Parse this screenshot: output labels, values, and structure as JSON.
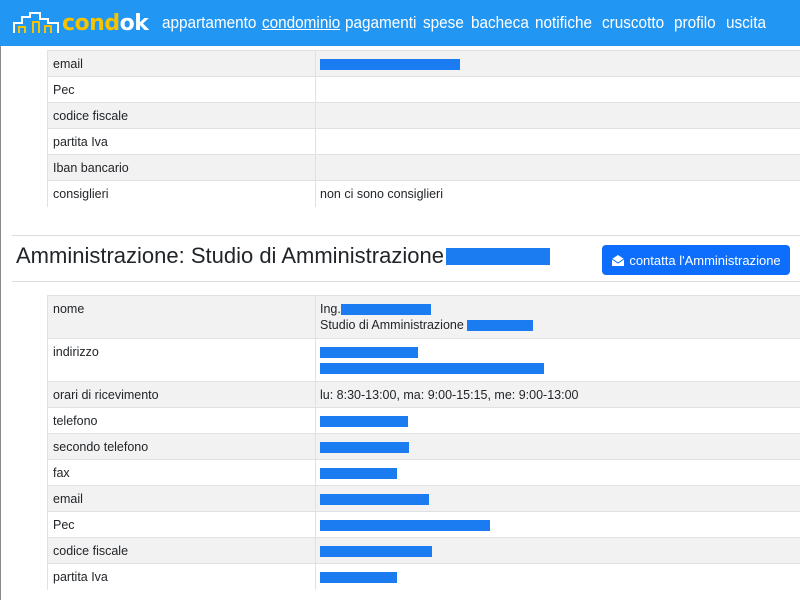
{
  "brand": {
    "logo_part1": "cond",
    "logo_part2": "ok"
  },
  "nav": {
    "items": [
      {
        "label": "appartamento"
      },
      {
        "label": "condominio"
      },
      {
        "label": "pagamenti"
      },
      {
        "label": "spese"
      },
      {
        "label": "bacheca"
      },
      {
        "label": "notifiche"
      },
      {
        "label": "cruscotto"
      },
      {
        "label": "profilo"
      },
      {
        "label": "uscita"
      }
    ]
  },
  "condominio_table": {
    "rows": [
      {
        "label": "email",
        "value": ""
      },
      {
        "label": "Pec",
        "value": ""
      },
      {
        "label": "codice fiscale",
        "value": ""
      },
      {
        "label": "partita Iva",
        "value": ""
      },
      {
        "label": "Iban bancario",
        "value": ""
      },
      {
        "label": "consiglieri",
        "value": "non ci sono consiglieri"
      }
    ]
  },
  "admin_section": {
    "title": "Amministrazione: Studio di Amministrazione",
    "contact_button": "contatta l'Amministrazione",
    "icon": "envelope-open-icon"
  },
  "admin_table": {
    "rows": [
      {
        "label": "nome",
        "line1": "Ing.",
        "line2": "Studio di Amministrazione"
      },
      {
        "label": "indirizzo",
        "value": ""
      },
      {
        "label": "orari di ricevimento",
        "value": "lu: 8:30-13:00, ma: 9:00-15:15, me: 9:00-13:00"
      },
      {
        "label": "telefono",
        "value": ""
      },
      {
        "label": "secondo telefono",
        "value": ""
      },
      {
        "label": "fax",
        "value": ""
      },
      {
        "label": "email",
        "value": ""
      },
      {
        "label": "Pec",
        "value": ""
      },
      {
        "label": "codice fiscale",
        "value": ""
      },
      {
        "label": "partita Iva",
        "value": ""
      }
    ]
  },
  "colors": {
    "navbar": "#2196f3",
    "logo_accent": "#f7c300",
    "button": "#0d6efd",
    "redaction": "#1a7cf0"
  }
}
